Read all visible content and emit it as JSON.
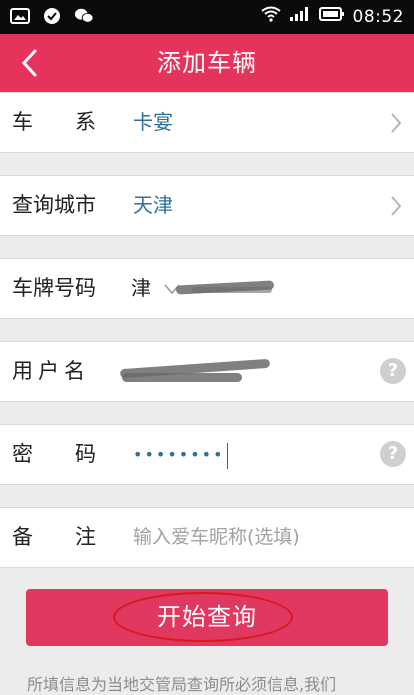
{
  "status_bar": {
    "time": "08:52"
  },
  "header": {
    "title": "添加车辆",
    "back_icon": "chevron-left-icon"
  },
  "form": {
    "series": {
      "label": "车　　系",
      "value": "卡宴"
    },
    "city": {
      "label": "查询城市",
      "value": "天津"
    },
    "plate": {
      "label": "车牌号码",
      "prefix": "津"
    },
    "username": {
      "label": "用户名"
    },
    "password": {
      "label": "密　　码",
      "value": "••••••••"
    },
    "remark": {
      "label": "备　　注",
      "placeholder": "输入爱车昵称(选填)"
    }
  },
  "actions": {
    "start_query": "开始查询"
  },
  "notice": "所填信息为当地交管局查询所必须信息,我们",
  "colors": {
    "brand": "#e5335c",
    "link": "#2f6f9c",
    "highlight_circle": "#d7181f"
  }
}
